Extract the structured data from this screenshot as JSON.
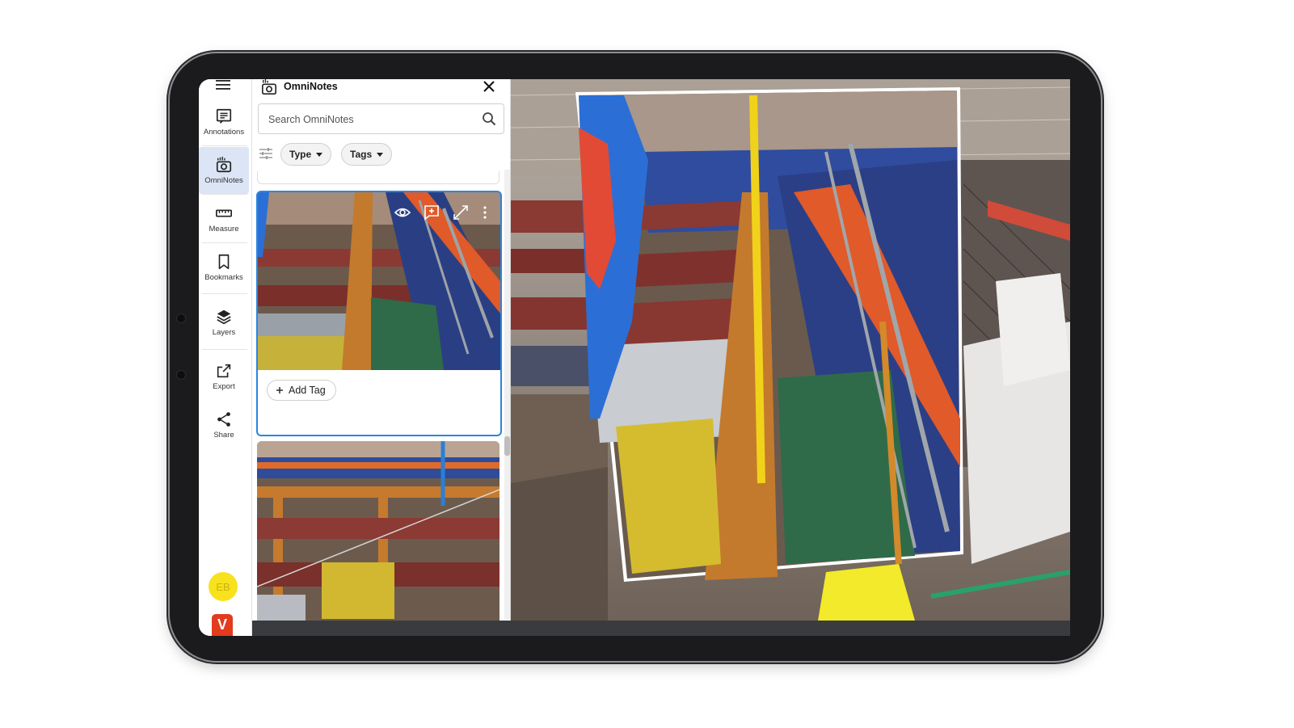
{
  "rail": {
    "items": [
      {
        "label": "Annotations",
        "icon": "annotations-icon"
      },
      {
        "label": "OmniNotes",
        "icon": "omninotes-icon",
        "active": true
      },
      {
        "label": "Measure",
        "icon": "ruler-icon"
      },
      {
        "label": "Bookmarks",
        "icon": "bookmark-icon"
      },
      {
        "label": "Layers",
        "icon": "layers-icon"
      },
      {
        "label": "Export",
        "icon": "export-icon"
      },
      {
        "label": "Share",
        "icon": "share-icon"
      }
    ],
    "avatar_initials": "EB",
    "logo_letter": "V",
    "avatar_color": "#f7e21d",
    "logo_color": "#e23b1e",
    "active_color": "#dce5f5"
  },
  "panel": {
    "title": "OmniNotes",
    "search": {
      "placeholder": "Search OmniNotes",
      "value": ""
    },
    "filters": [
      {
        "label": "Type"
      },
      {
        "label": "Tags"
      }
    ],
    "cards": [
      {
        "selected": true,
        "add_tag_label": "Add Tag",
        "actions": [
          "eye-icon",
          "add-comment-icon",
          "expand-icon",
          "more-vertical-icon"
        ]
      },
      {
        "selected": false
      }
    ],
    "accent_color": "#2b86e0"
  }
}
